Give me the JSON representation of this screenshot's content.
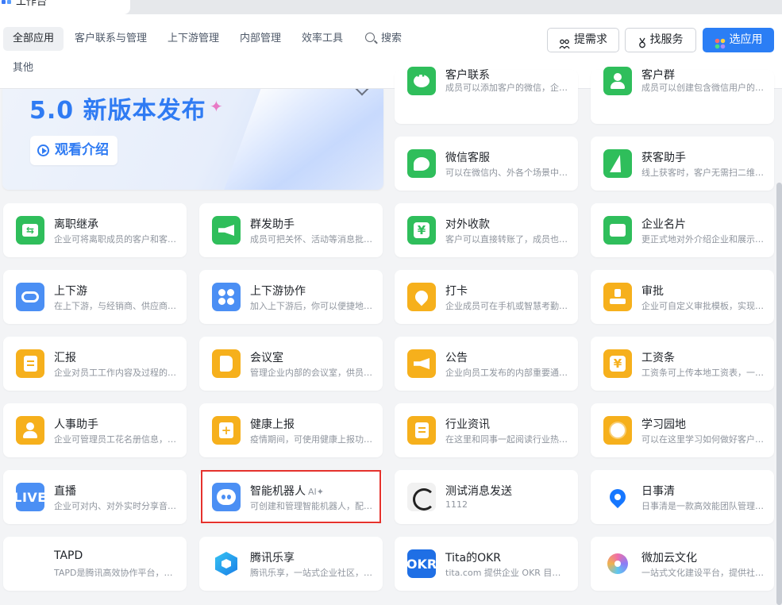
{
  "window": {
    "tab_label": "工作台"
  },
  "categories": {
    "all": "全部应用",
    "customer": "客户联系与管理",
    "updown": "上下游管理",
    "internal": "内部管理",
    "efficiency": "效率工具",
    "other": "其他"
  },
  "search": {
    "label": "搜索"
  },
  "buttons": {
    "needs": "提需求",
    "service": "找服务",
    "choose": "选应用"
  },
  "banner": {
    "title": "5.0 新版本发布",
    "watch": "观看介绍"
  },
  "colors": {
    "primary": "#2b7ef5",
    "green": "#2fbe5b",
    "blue": "#4b8ff4",
    "orange": "#f6b01c",
    "highlight": "#e5322d"
  },
  "apps": [
    {
      "title": "客户联系",
      "desc": "成员可以添加客户的微信，企业可...",
      "icon": "chat-icon"
    },
    {
      "title": "客户群",
      "desc": "成员可以创建包含微信用户的客户群",
      "icon": "group-icon"
    },
    {
      "title": "微信客服",
      "desc": "可以在微信内、外各个场景中接入...",
      "icon": "bubble-icon"
    },
    {
      "title": "获客助手",
      "desc": "线上获客时，客户无需扫二维码即可",
      "icon": "bolt-icon"
    },
    {
      "title": "离职继承",
      "desc": "企业可将离职成员的客户和客户群...",
      "icon": "transfer-icon"
    },
    {
      "title": "群发助手",
      "desc": "成员可把关怀、活动等消息批量发...",
      "icon": "megaphone-icon"
    },
    {
      "title": "对外收款",
      "desc": "客户可以直接转账了，成员也可以...",
      "icon": "yen-icon"
    },
    {
      "title": "企业名片",
      "desc": "更正式地对外介绍企业和展示成员...",
      "icon": "card-icon"
    },
    {
      "title": "上下游",
      "desc": "在上下游，与经销商、供应商等伙...",
      "icon": "link-icon"
    },
    {
      "title": "上下游协作",
      "desc": "加入上下游后，你可以便捷地与上...",
      "icon": "grid-icon"
    },
    {
      "title": "打卡",
      "desc": "企业成员可在手机或智慧考勤机上...",
      "icon": "location-icon"
    },
    {
      "title": "审批",
      "desc": "企业可自定义审批模板，实现高效...",
      "icon": "stamp-icon"
    },
    {
      "title": "汇报",
      "desc": "企业对员工工作内容及过程的记录...",
      "icon": "report-icon"
    },
    {
      "title": "会议室",
      "desc": "管理企业内部的会议室，供员工预...",
      "icon": "door-icon"
    },
    {
      "title": "公告",
      "desc": "企业向员工发布的内部重要通知，...",
      "icon": "announce-icon"
    },
    {
      "title": "工资条",
      "desc": "工资条可上传本地工资表，一键发...",
      "icon": "payslip-icon"
    },
    {
      "title": "人事助手",
      "desc": "企业可管理员工花名册信息，及入...",
      "icon": "person-icon"
    },
    {
      "title": "健康上报",
      "desc": "疫情期间，可使用健康上报功能，...",
      "icon": "health-icon"
    },
    {
      "title": "行业资讯",
      "desc": "在这里和同事一起阅读行业热点资讯",
      "icon": "news-icon"
    },
    {
      "title": "学习园地",
      "desc": "可以在这里学习如何做好客户服务...",
      "icon": "planet-icon"
    },
    {
      "title": "直播",
      "desc": "企业可对内、对外实时分享音视频...",
      "icon": "live-icon",
      "badge": "LIVE"
    },
    {
      "title": "智能机器人",
      "desc": "可创建和管理智能机器人，配置在...",
      "icon": "robot-icon",
      "tag": "AI✦"
    },
    {
      "title": "测试消息发送",
      "desc": "1112",
      "icon": "ink-logo-icon"
    },
    {
      "title": "日事清",
      "desc": "日事清是一款高效能团队管理协作...",
      "icon": "pin-logo-icon"
    },
    {
      "title": "TAPD",
      "desc": "TAPD是腾讯高效协作平台，助力...",
      "icon": "tapd-logo-icon",
      "badge": "tapd"
    },
    {
      "title": "腾讯乐享",
      "desc": "腾讯乐享，一站式企业社区，为企...",
      "icon": "hexagon-logo-icon"
    },
    {
      "title": "Tita的OKR",
      "desc": "tita.com 提供企业 OKR 目标管理...",
      "icon": "okr-logo-icon",
      "badge": "OKR"
    },
    {
      "title": "微加云文化",
      "desc": "一站式文化建设平台，提供社区、...",
      "icon": "flower-logo-icon"
    }
  ]
}
